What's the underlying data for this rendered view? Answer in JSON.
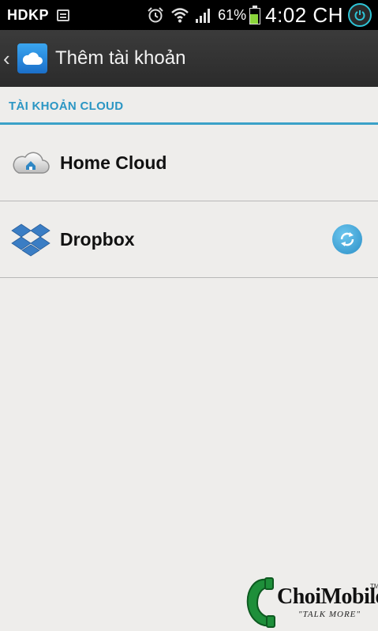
{
  "status_bar": {
    "carrier": "HDKP",
    "battery_percent": "61%",
    "battery_level": 0.61,
    "time": "4:02 CH",
    "icons": [
      "notification-icon",
      "alarm-icon",
      "wifi-icon",
      "signal-icon",
      "battery-icon",
      "power-icon"
    ]
  },
  "action_bar": {
    "title": "Thêm tài khoản",
    "back_glyph": "‹",
    "app_icon": "cloud-icon"
  },
  "section": {
    "header": "TÀI KHOẢN CLOUD"
  },
  "accounts": [
    {
      "label": "Home Cloud",
      "icon": "home-cloud-icon"
    },
    {
      "label": "Dropbox",
      "icon": "dropbox-icon",
      "action_icon": "sync-icon"
    }
  ],
  "colors": {
    "accent": "#2b96c4",
    "background": "#eeedeb",
    "action_bar": "#333333",
    "status_bar": "#000000"
  },
  "watermark": {
    "brand": "ChoiMobile",
    "tagline": "\"TALK MORE\"",
    "tm": "TM"
  }
}
